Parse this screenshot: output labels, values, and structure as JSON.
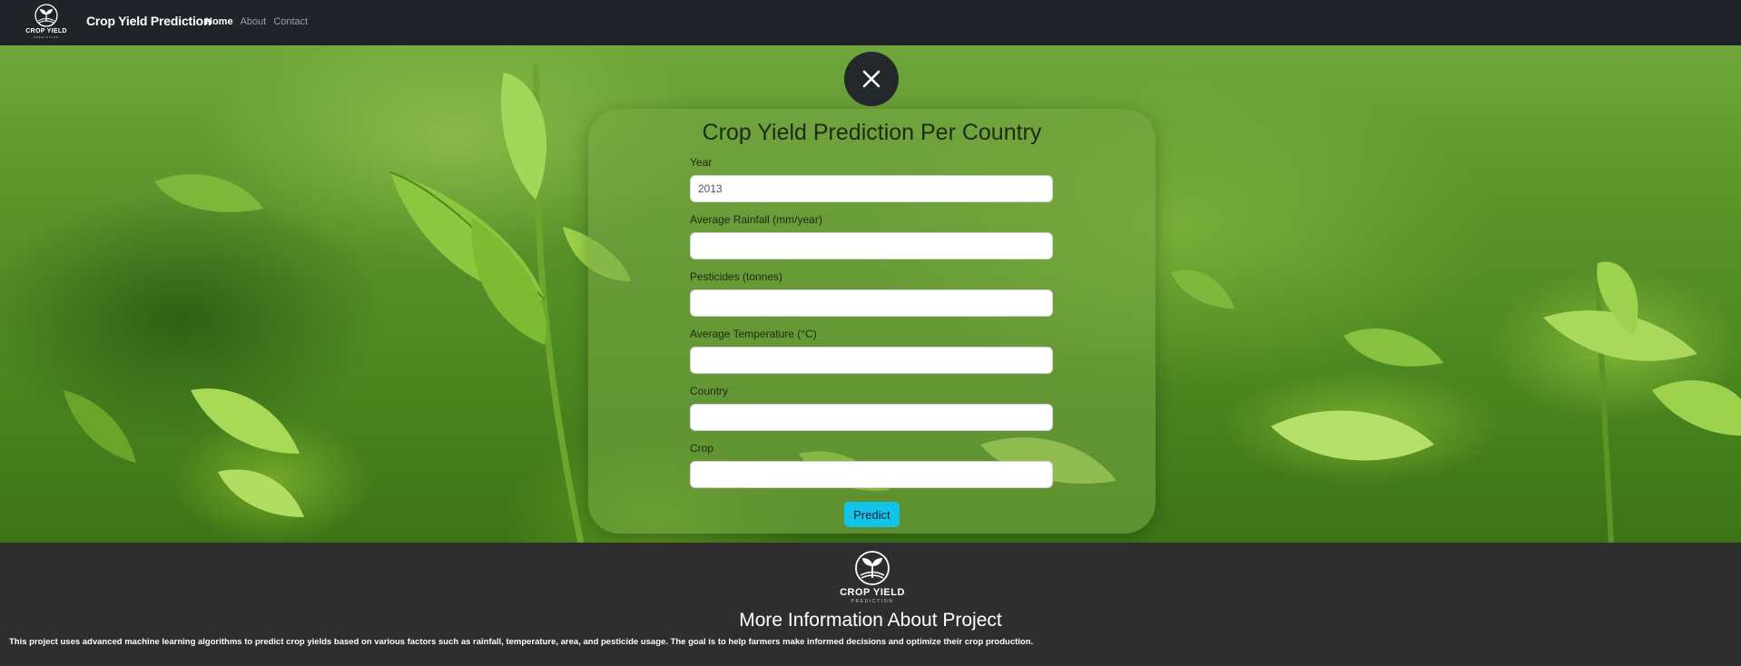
{
  "navbar": {
    "logo": {
      "text": "CROP YIELD",
      "sub": "PREDICTION",
      "icon": "sprout-icon"
    },
    "brand": "Crop Yield Prediction",
    "links": [
      {
        "label": "Home",
        "active": true
      },
      {
        "label": "About",
        "active": false
      },
      {
        "label": "Contact",
        "active": false
      }
    ]
  },
  "modal": {
    "title": "Crop Yield Prediction Per Country",
    "close_icon": "close-icon",
    "fields": [
      {
        "label": "Year",
        "value": "2013",
        "placeholder": ""
      },
      {
        "label": "Average Rainfall (mm/year)",
        "value": "",
        "placeholder": ""
      },
      {
        "label": "Pesticides (tonnes)",
        "value": "",
        "placeholder": ""
      },
      {
        "label": "Average Temperature (°C)",
        "value": "",
        "placeholder": ""
      },
      {
        "label": "Country",
        "value": "",
        "placeholder": ""
      },
      {
        "label": "Crop",
        "value": "",
        "placeholder": ""
      }
    ],
    "submit_label": "Predict"
  },
  "footer": {
    "logo": {
      "text": "CROP YIELD",
      "sub": "PREDICTION",
      "icon": "sprout-icon"
    },
    "title": "More Information About Project",
    "description": "This project uses advanced machine learning algorithms to predict crop yields based on various factors such as rainfall, temperature, area, and pesticide usage. The goal is to help farmers make informed decisions and optimize their crop production."
  },
  "colors": {
    "navbar_bg": "#202328",
    "footer_bg": "#2e2e2e",
    "accent_button": "#12c3ea",
    "close_button_bg": "#23282a"
  }
}
